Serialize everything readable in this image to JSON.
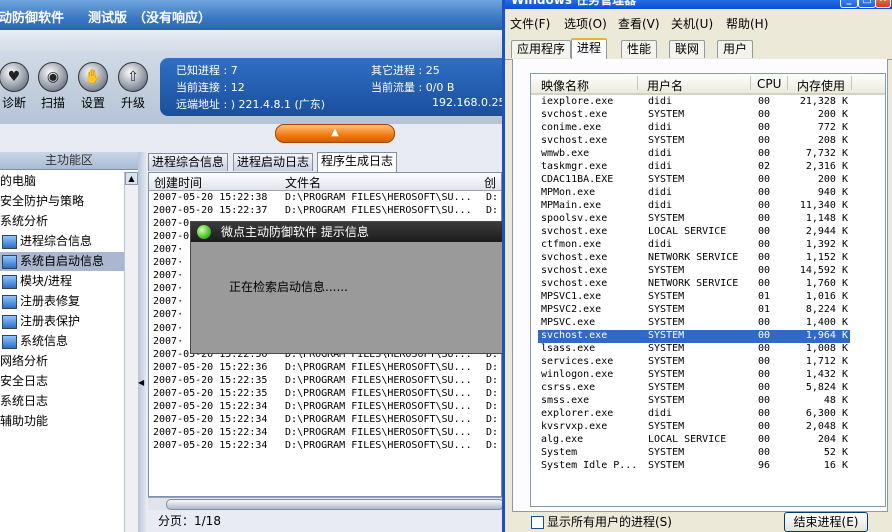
{
  "left_app": {
    "title_name": "动防御软件",
    "title_version": "测试版",
    "title_status": "（没有响应）",
    "toolbar": [
      {
        "label": "诊断",
        "icon": "heart-icon"
      },
      {
        "label": "扫描",
        "icon": "scan-icon"
      },
      {
        "label": "设置",
        "icon": "settings-icon"
      },
      {
        "label": "升级",
        "icon": "upgrade-icon"
      }
    ],
    "info": {
      "known_processes": "已知进程 : 7",
      "other_processes": "其它进程 : 25",
      "current_connections": "当前连接 : 12",
      "current_traffic": "当前流量 : 0/0 B",
      "remote_address": "远端地址 : )    221.4.8.1 (广东)",
      "remote_ip": "192.168.0.25"
    },
    "sidebar_header": "主功能区",
    "sidebar_items": [
      {
        "label": "的电脑",
        "indent": 0,
        "selected": false,
        "icon": false
      },
      {
        "label": "安全防护与策略",
        "indent": 0,
        "selected": false,
        "icon": false
      },
      {
        "label": "系统分析",
        "indent": 0,
        "selected": false,
        "icon": false
      },
      {
        "label": "进程综合信息",
        "indent": 1,
        "selected": false,
        "icon": true
      },
      {
        "label": "系统自启动信息",
        "indent": 1,
        "selected": true,
        "icon": true
      },
      {
        "label": "模块/进程",
        "indent": 1,
        "selected": false,
        "icon": true
      },
      {
        "label": "注册表修复",
        "indent": 1,
        "selected": false,
        "icon": true
      },
      {
        "label": "注册表保护",
        "indent": 1,
        "selected": false,
        "icon": true
      },
      {
        "label": "系统信息",
        "indent": 1,
        "selected": false,
        "icon": true
      },
      {
        "label": "网络分析",
        "indent": 0,
        "selected": false,
        "icon": false
      },
      {
        "label": "安全日志",
        "indent": 0,
        "selected": false,
        "icon": false
      },
      {
        "label": "系统日志",
        "indent": 0,
        "selected": false,
        "icon": false
      },
      {
        "label": "辅助功能",
        "indent": 0,
        "selected": false,
        "icon": false
      }
    ],
    "tabs": [
      "进程综合信息",
      "进程启动日志",
      "程序生成日志"
    ],
    "active_tab": 2,
    "columns": [
      "创建时间",
      "文件名",
      "创"
    ],
    "rows": [
      {
        "time": "2007-05-20 15:22:38",
        "file": "D:\\PROGRAM FILES\\HEROSOFT\\SU...",
        "c3": "D:"
      },
      {
        "time": "2007-05-20 15:22:37",
        "file": "D:\\PROGRAM FILES\\HEROSOFT\\SU...",
        "c3": "D:"
      },
      {
        "time": "2007-0",
        "file": "",
        "c3": ""
      },
      {
        "time": "2007-0",
        "file": "",
        "c3": ""
      },
      {
        "time": "2007·",
        "file": "",
        "c3": ""
      },
      {
        "time": "2007·",
        "file": "",
        "c3": ""
      },
      {
        "time": "2007·",
        "file": "",
        "c3": ""
      },
      {
        "time": "2007·",
        "file": "",
        "c3": ""
      },
      {
        "time": "2007·",
        "file": "",
        "c3": ""
      },
      {
        "time": "2007·",
        "file": "",
        "c3": ""
      },
      {
        "time": "2007·",
        "file": "",
        "c3": ""
      },
      {
        "time": "2007·",
        "file": "",
        "c3": ""
      },
      {
        "time": "2007-05-20 15:22:36",
        "file": "D:\\PROGRAM FILES\\HEROSOFT\\SU...",
        "c3": "D:"
      },
      {
        "time": "2007-05-20 15:22:36",
        "file": "D:\\PROGRAM FILES\\HEROSOFT\\SU...",
        "c3": "D:"
      },
      {
        "time": "2007-05-20 15:22:35",
        "file": "D:\\PROGRAM FILES\\HEROSOFT\\SU...",
        "c3": "D:"
      },
      {
        "time": "2007-05-20 15:22:35",
        "file": "D:\\PROGRAM FILES\\HEROSOFT\\SU...",
        "c3": "D:"
      },
      {
        "time": "2007-05-20 15:22:34",
        "file": "D:\\PROGRAM FILES\\HEROSOFT\\SU...",
        "c3": "D:"
      },
      {
        "time": "2007-05-20 15:22:34",
        "file": "D:\\PROGRAM FILES\\HEROSOFT\\SU...",
        "c3": "D:"
      },
      {
        "time": "2007-05-20 15:22:34",
        "file": "D:\\PROGRAM FILES\\HEROSOFT\\SU...",
        "c3": "D:"
      },
      {
        "time": "2007-05-20 15:22:34",
        "file": "D:\\PROGRAM FILES\\HEROSOFT\\SU...",
        "c3": "D:"
      }
    ],
    "pager": "分页：1/18",
    "dialog": {
      "title": "微点主动防御软件   提示信息",
      "message": "正在检索启动信息......"
    }
  },
  "task_manager": {
    "title": "Windows 任务管理器",
    "menus": [
      "文件(F)",
      "选项(O)",
      "查看(V)",
      "关机(U)",
      "帮助(H)"
    ],
    "tabs": [
      "应用程序",
      "进程",
      "性能",
      "联网",
      "用户"
    ],
    "active_tab": 1,
    "columns": [
      "映像名称",
      "用户名",
      "CPU",
      "内存使用"
    ],
    "processes": [
      {
        "name": "iexplore.exe",
        "user": "didi",
        "cpu": "00",
        "mem": "21,328 K"
      },
      {
        "name": "svchost.exe",
        "user": "SYSTEM",
        "cpu": "00",
        "mem": "200 K"
      },
      {
        "name": "conime.exe",
        "user": "didi",
        "cpu": "00",
        "mem": "772 K"
      },
      {
        "name": "svchost.exe",
        "user": "SYSTEM",
        "cpu": "00",
        "mem": "208 K"
      },
      {
        "name": "wmwb.exe",
        "user": "didi",
        "cpu": "00",
        "mem": "7,732 K"
      },
      {
        "name": "taskmgr.exe",
        "user": "didi",
        "cpu": "02",
        "mem": "2,316 K"
      },
      {
        "name": "CDAC11BA.EXE",
        "user": "SYSTEM",
        "cpu": "00",
        "mem": "200 K"
      },
      {
        "name": "MPMon.exe",
        "user": "didi",
        "cpu": "00",
        "mem": "940 K"
      },
      {
        "name": "MPMain.exe",
        "user": "didi",
        "cpu": "00",
        "mem": "11,340 K"
      },
      {
        "name": "spoolsv.exe",
        "user": "SYSTEM",
        "cpu": "00",
        "mem": "1,148 K"
      },
      {
        "name": "svchost.exe",
        "user": "LOCAL SERVICE",
        "cpu": "00",
        "mem": "2,944 K"
      },
      {
        "name": "ctfmon.exe",
        "user": "didi",
        "cpu": "00",
        "mem": "1,392 K"
      },
      {
        "name": "svchost.exe",
        "user": "NETWORK SERVICE",
        "cpu": "00",
        "mem": "1,152 K"
      },
      {
        "name": "svchost.exe",
        "user": "SYSTEM",
        "cpu": "00",
        "mem": "14,592 K"
      },
      {
        "name": "svchost.exe",
        "user": "NETWORK SERVICE",
        "cpu": "00",
        "mem": "1,760 K"
      },
      {
        "name": "MPSVC1.exe",
        "user": "SYSTEM",
        "cpu": "01",
        "mem": "1,016 K"
      },
      {
        "name": "MPSVC2.exe",
        "user": "SYSTEM",
        "cpu": "01",
        "mem": "8,224 K"
      },
      {
        "name": "MPSVC.exe",
        "user": "SYSTEM",
        "cpu": "00",
        "mem": "1,400 K"
      },
      {
        "name": "svchost.exe",
        "user": "SYSTEM",
        "cpu": "00",
        "mem": "1,964 K"
      },
      {
        "name": "lsass.exe",
        "user": "SYSTEM",
        "cpu": "00",
        "mem": "1,008 K"
      },
      {
        "name": "services.exe",
        "user": "SYSTEM",
        "cpu": "00",
        "mem": "1,712 K"
      },
      {
        "name": "winlogon.exe",
        "user": "SYSTEM",
        "cpu": "00",
        "mem": "1,432 K"
      },
      {
        "name": "csrss.exe",
        "user": "SYSTEM",
        "cpu": "00",
        "mem": "5,824 K"
      },
      {
        "name": "smss.exe",
        "user": "SYSTEM",
        "cpu": "00",
        "mem": "48 K"
      },
      {
        "name": "explorer.exe",
        "user": "didi",
        "cpu": "00",
        "mem": "6,300 K"
      },
      {
        "name": "kvsrvxp.exe",
        "user": "SYSTEM",
        "cpu": "00",
        "mem": "2,048 K"
      },
      {
        "name": "alg.exe",
        "user": "LOCAL SERVICE",
        "cpu": "00",
        "mem": "204 K"
      },
      {
        "name": "System",
        "user": "SYSTEM",
        "cpu": "00",
        "mem": "52 K"
      },
      {
        "name": "System Idle P...",
        "user": "SYSTEM",
        "cpu": "96",
        "mem": "16 K"
      }
    ],
    "selected_row": 18,
    "show_all_users": "显示所有用户的进程(S)",
    "end_process": "结束进程(E)"
  }
}
